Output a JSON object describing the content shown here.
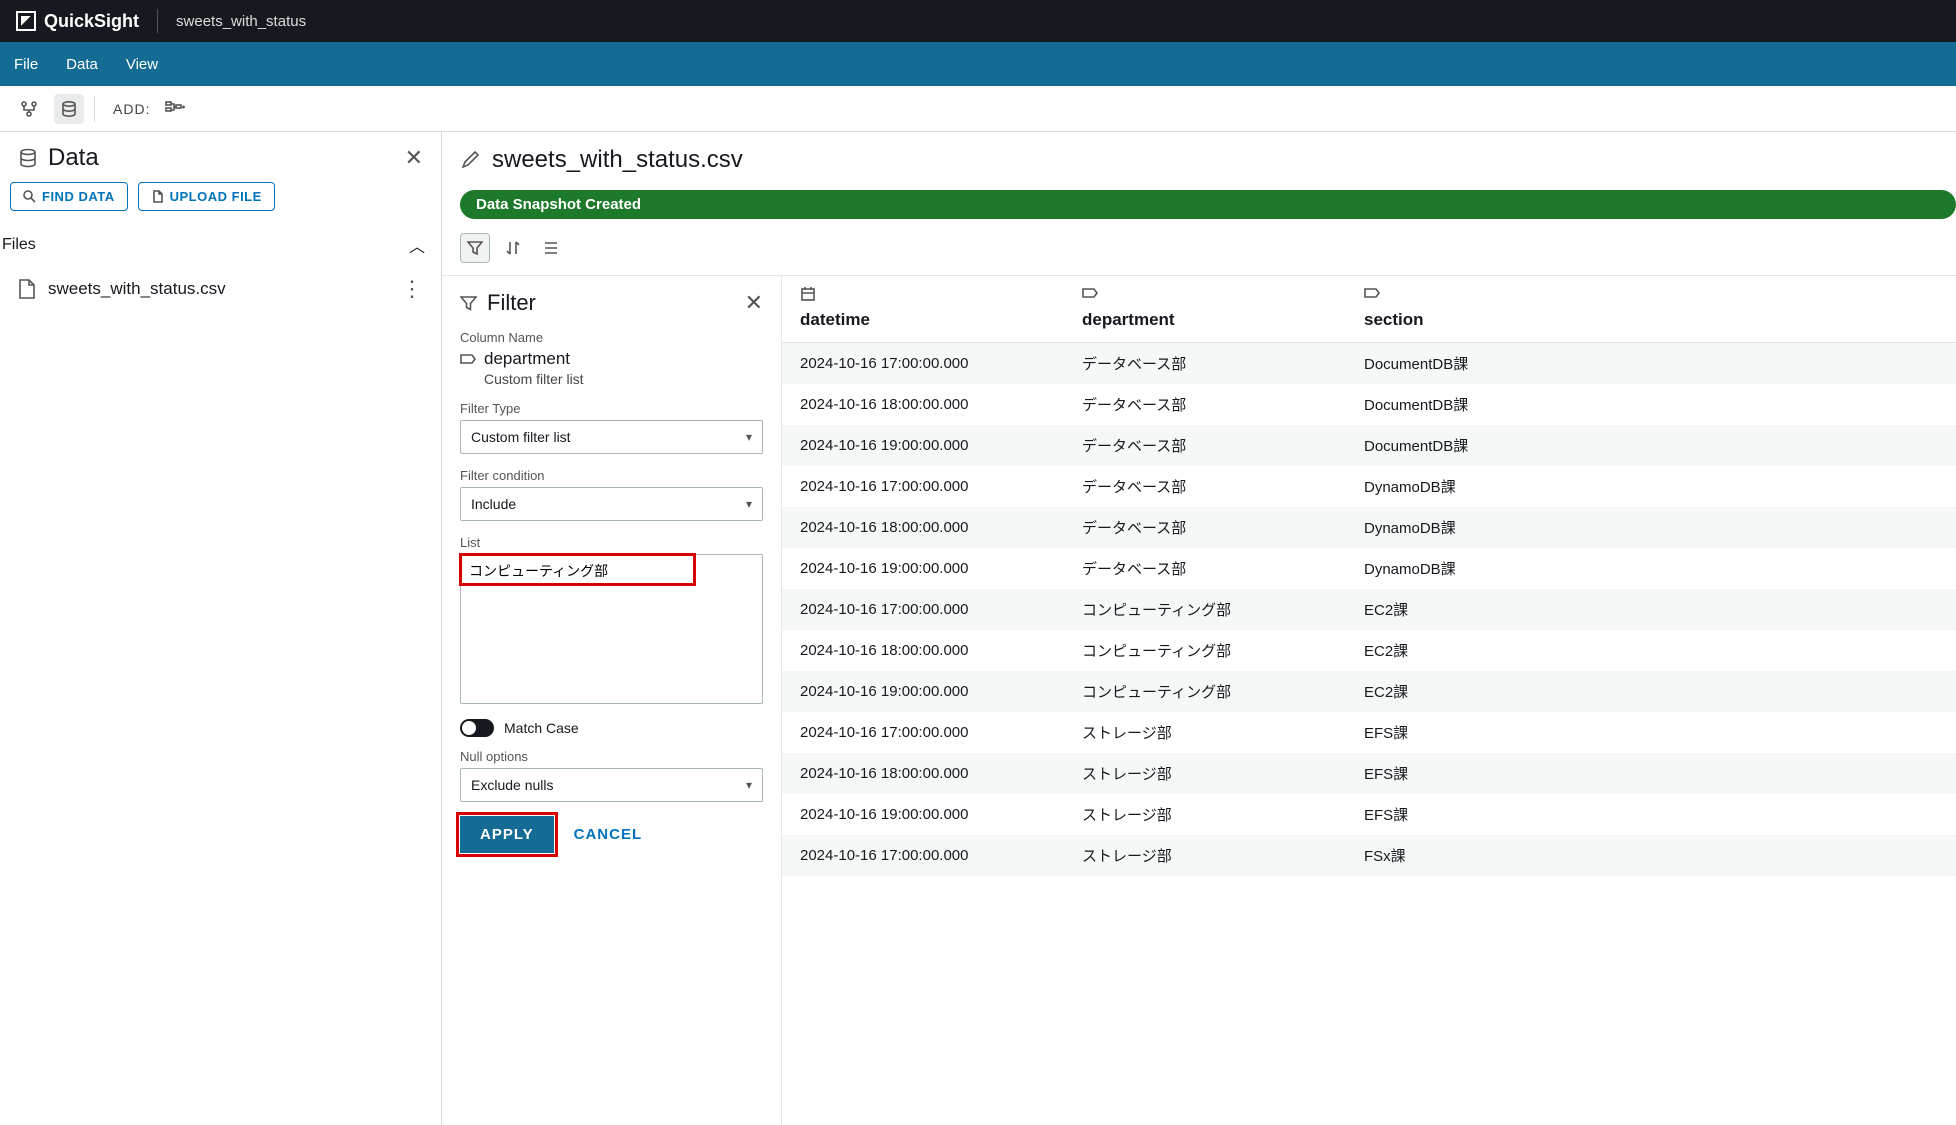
{
  "topbar": {
    "brand": "QuickSight",
    "title": "sweets_with_status"
  },
  "menubar": {
    "file": "File",
    "data": "Data",
    "view": "View"
  },
  "toolbar": {
    "add": "ADD:"
  },
  "sidebar": {
    "title": "Data",
    "find_data": "FIND DATA",
    "upload_file": "UPLOAD FILE",
    "files_hdr": "Files",
    "file_name": "sweets_with_status.csv"
  },
  "content": {
    "title": "sweets_with_status.csv",
    "badge": "Data Snapshot Created"
  },
  "filter": {
    "title": "Filter",
    "col_lbl": "Column Name",
    "col_val": "department",
    "col_sub": "Custom filter list",
    "type_lbl": "Filter Type",
    "type_val": "Custom filter list",
    "cond_lbl": "Filter condition",
    "cond_val": "Include",
    "list_lbl": "List",
    "list_val": "コンピューティング部",
    "match_case": "Match Case",
    "null_lbl": "Null options",
    "null_val": "Exclude nulls",
    "apply": "APPLY",
    "cancel": "CANCEL"
  },
  "table": {
    "cols": {
      "datetime": "datetime",
      "department": "department",
      "section": "section"
    },
    "rows": [
      {
        "dt": "2024-10-16 17:00:00.000",
        "dep": "データベース部",
        "sec": "DocumentDB課"
      },
      {
        "dt": "2024-10-16 18:00:00.000",
        "dep": "データベース部",
        "sec": "DocumentDB課"
      },
      {
        "dt": "2024-10-16 19:00:00.000",
        "dep": "データベース部",
        "sec": "DocumentDB課"
      },
      {
        "dt": "2024-10-16 17:00:00.000",
        "dep": "データベース部",
        "sec": "DynamoDB課"
      },
      {
        "dt": "2024-10-16 18:00:00.000",
        "dep": "データベース部",
        "sec": "DynamoDB課"
      },
      {
        "dt": "2024-10-16 19:00:00.000",
        "dep": "データベース部",
        "sec": "DynamoDB課"
      },
      {
        "dt": "2024-10-16 17:00:00.000",
        "dep": "コンピューティング部",
        "sec": "EC2課"
      },
      {
        "dt": "2024-10-16 18:00:00.000",
        "dep": "コンピューティング部",
        "sec": "EC2課"
      },
      {
        "dt": "2024-10-16 19:00:00.000",
        "dep": "コンピューティング部",
        "sec": "EC2課"
      },
      {
        "dt": "2024-10-16 17:00:00.000",
        "dep": "ストレージ部",
        "sec": "EFS課"
      },
      {
        "dt": "2024-10-16 18:00:00.000",
        "dep": "ストレージ部",
        "sec": "EFS課"
      },
      {
        "dt": "2024-10-16 19:00:00.000",
        "dep": "ストレージ部",
        "sec": "EFS課"
      },
      {
        "dt": "2024-10-16 17:00:00.000",
        "dep": "ストレージ部",
        "sec": "FSx課"
      }
    ]
  }
}
